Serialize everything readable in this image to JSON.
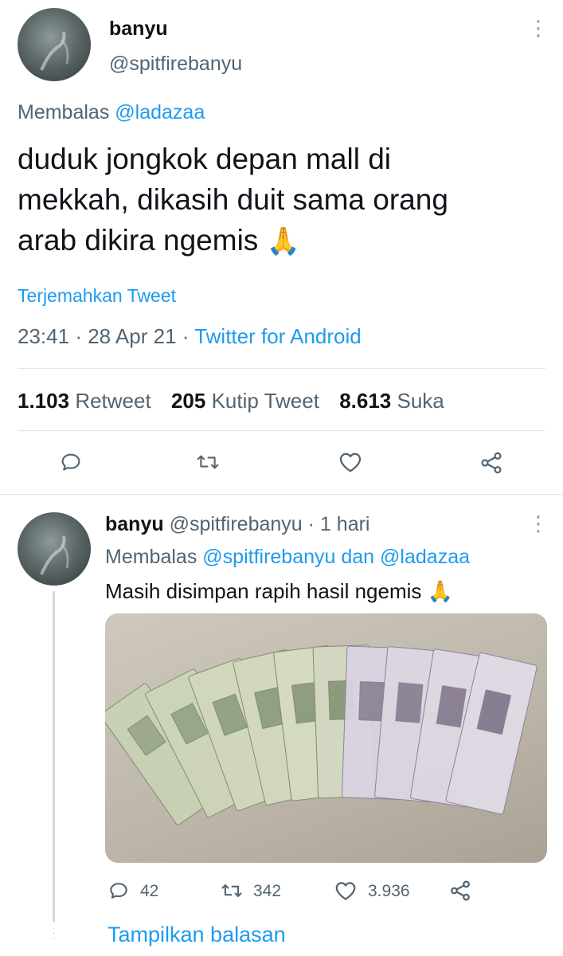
{
  "main_tweet": {
    "display_name": "banyu",
    "handle": "@spitfirebanyu",
    "replying_prefix": "Membalas",
    "replying_to": "@ladazaa",
    "text_lines": [
      "duduk jongkok depan mall di",
      "mekkah, dikasih duit sama orang",
      "arab dikira ngemis"
    ],
    "emoji": "🙏",
    "translate_label": "Terjemahkan Tweet",
    "time": "23:41",
    "separator": "·",
    "date": "28 Apr 21",
    "source": "Twitter for Android",
    "stats": {
      "retweets_count": "1.103",
      "retweets_label": "Retweet",
      "quotes_count": "205",
      "quotes_label": "Kutip Tweet",
      "likes_count": "8.613",
      "likes_label": "Suka"
    },
    "actions": [
      "reply-icon",
      "retweet-icon",
      "like-icon",
      "share-icon"
    ]
  },
  "reply_tweet": {
    "display_name": "banyu",
    "handle": "@spitfirebanyu",
    "separator": "·",
    "time_ago": "1 hari",
    "replying_prefix": "Membalas",
    "replying_to_1": "@spitfirebanyu",
    "conjunction": "dan",
    "replying_to_2": "@ladazaa",
    "text": "Masih disimpan rapih hasil ngemis",
    "emoji": "🙏",
    "reply_count": "42",
    "retweet_count": "342",
    "like_count": "3.936"
  },
  "show_replies_label": "Tampilkan balasan",
  "colors": {
    "accent": "#1d9bf0",
    "secondary_text": "#536471",
    "primary_text": "#0f1419",
    "divider": "#e1e8ed"
  }
}
